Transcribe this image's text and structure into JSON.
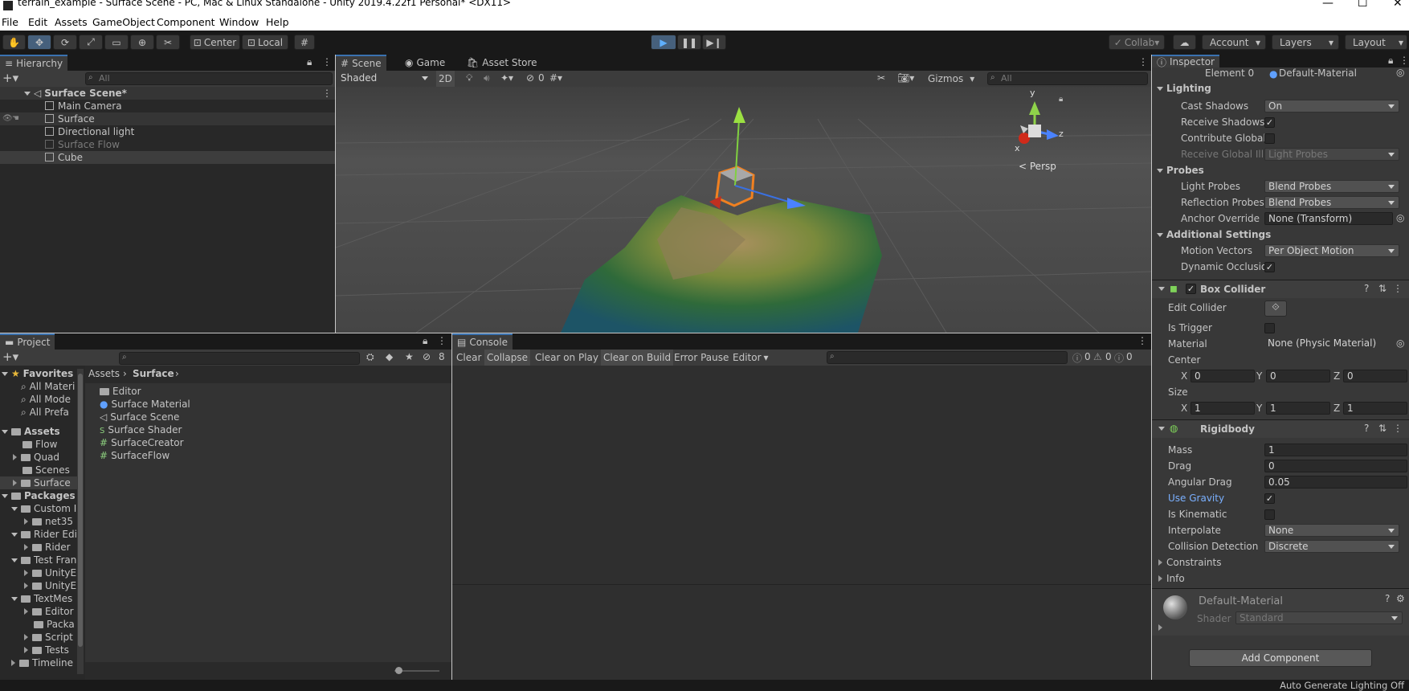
{
  "window": {
    "title": "terrain_example - Surface Scene - PC, Mac & Linux Standalone - Unity 2019.4.22f1 Personal* <DX11>"
  },
  "menu": [
    "File",
    "Edit",
    "Assets",
    "GameObject",
    "Component",
    "Window",
    "Help"
  ],
  "toolbar": {
    "pivot": "Center",
    "space": "Local",
    "collab": "Collab",
    "account": "Account",
    "layers": "Layers",
    "layout": "Layout"
  },
  "hierarchy": {
    "tab": "Hierarchy",
    "search_placeholder": "All",
    "scene": "Surface Scene*",
    "items": [
      {
        "label": "Main Camera",
        "dim": false
      },
      {
        "label": "Surface",
        "dim": false
      },
      {
        "label": "Directional light",
        "dim": false
      },
      {
        "label": "Surface Flow",
        "dim": true
      },
      {
        "label": "Cube",
        "dim": false
      }
    ]
  },
  "scene_view": {
    "tabs": [
      "Scene",
      "Game",
      "Asset Store"
    ],
    "shading": "Shaded",
    "mode_2d": "2D",
    "hidden_count": "0",
    "gizmos": "Gizmos",
    "search_placeholder": "All",
    "gizmo_axes": {
      "y": "y",
      "x": "x",
      "z": "z"
    },
    "projection": "Persp"
  },
  "project": {
    "tab": "Project",
    "hidden_count": "8",
    "favorites_label": "Favorites",
    "favorites": [
      "All Materi",
      "All Mode",
      "All Prefa"
    ],
    "assets_label": "Assets",
    "assets": [
      "Flow",
      "Quad",
      "Scenes",
      "Surface"
    ],
    "packages_label": "Packages",
    "packages": [
      {
        "label": "Custom I",
        "depth": 1,
        "open": true
      },
      {
        "label": "net35",
        "depth": 2,
        "open": false
      },
      {
        "label": "Rider Edi",
        "depth": 1,
        "open": true
      },
      {
        "label": "Rider",
        "depth": 2,
        "open": false
      },
      {
        "label": "Test Fran",
        "depth": 1,
        "open": true
      },
      {
        "label": "UnityE",
        "depth": 2,
        "open": false
      },
      {
        "label": "UnityE",
        "depth": 2,
        "open": false
      },
      {
        "label": "TextMes",
        "depth": 1,
        "open": true
      },
      {
        "label": "Editor",
        "depth": 2,
        "open": false
      },
      {
        "label": "Packa",
        "depth": 2,
        "open": false
      },
      {
        "label": "Script",
        "depth": 2,
        "open": false
      },
      {
        "label": "Tests",
        "depth": 2,
        "open": false
      },
      {
        "label": "Timeline",
        "depth": 1,
        "open": false
      }
    ],
    "breadcrumb": [
      "Assets",
      "Surface"
    ],
    "files": [
      {
        "label": "Editor",
        "icon": "folder"
      },
      {
        "label": "Surface Material",
        "icon": "material"
      },
      {
        "label": "Surface Scene",
        "icon": "scene"
      },
      {
        "label": "Surface Shader",
        "icon": "shader"
      },
      {
        "label": "SurfaceCreator",
        "icon": "script"
      },
      {
        "label": "SurfaceFlow",
        "icon": "script"
      }
    ]
  },
  "console": {
    "tab": "Console",
    "buttons": [
      "Clear",
      "Collapse",
      "Clear on Play",
      "Clear on Build",
      "Error Pause",
      "Editor"
    ],
    "counts": {
      "info": "0",
      "warn": "0",
      "error": "0"
    }
  },
  "inspector": {
    "tab": "Inspector",
    "element0": {
      "label": "Element 0",
      "value": "Default-Material"
    },
    "lighting": {
      "header": "Lighting",
      "cast_shadows": {
        "label": "Cast Shadows",
        "value": "On"
      },
      "receive_shadows": {
        "label": "Receive Shadows",
        "checked": true
      },
      "contribute_gi": {
        "label": "Contribute Global I",
        "checked": false
      },
      "receive_gi": {
        "label": "Receive Global Illu",
        "value": "Light Probes"
      }
    },
    "probes": {
      "header": "Probes",
      "light_probes": {
        "label": "Light Probes",
        "value": "Blend Probes"
      },
      "reflection_probes": {
        "label": "Reflection Probes",
        "value": "Blend Probes"
      },
      "anchor_override": {
        "label": "Anchor Override",
        "value": "None (Transform)"
      }
    },
    "additional": {
      "header": "Additional Settings",
      "motion_vectors": {
        "label": "Motion Vectors",
        "value": "Per Object Motion"
      },
      "dynamic_occlusion": {
        "label": "Dynamic Occlusio",
        "checked": true
      }
    },
    "box_collider": {
      "header": "Box Collider",
      "edit_collider": "Edit Collider",
      "is_trigger": "Is Trigger",
      "material": {
        "label": "Material",
        "value": "None (Physic Material)"
      },
      "center": {
        "label": "Center",
        "x": "0",
        "y": "0",
        "z": "0"
      },
      "size": {
        "label": "Size",
        "x": "1",
        "y": "1",
        "z": "1"
      },
      "axis": {
        "x": "X",
        "y": "Y",
        "z": "Z"
      }
    },
    "rigidbody": {
      "header": "Rigidbody",
      "mass": {
        "label": "Mass",
        "value": "1"
      },
      "drag": {
        "label": "Drag",
        "value": "0"
      },
      "angular_drag": {
        "label": "Angular Drag",
        "value": "0.05"
      },
      "use_gravity": {
        "label": "Use Gravity",
        "checked": true
      },
      "is_kinematic": {
        "label": "Is Kinematic",
        "checked": false
      },
      "interpolate": {
        "label": "Interpolate",
        "value": "None"
      },
      "collision_detection": {
        "label": "Collision Detection",
        "value": "Discrete"
      },
      "constraints": "Constraints",
      "info": "Info"
    },
    "material": {
      "name": "Default-Material",
      "shader_label": "Shader",
      "shader": "Standard"
    },
    "add_component": "Add Component"
  },
  "status": {
    "text": "Auto Generate Lighting Off"
  }
}
